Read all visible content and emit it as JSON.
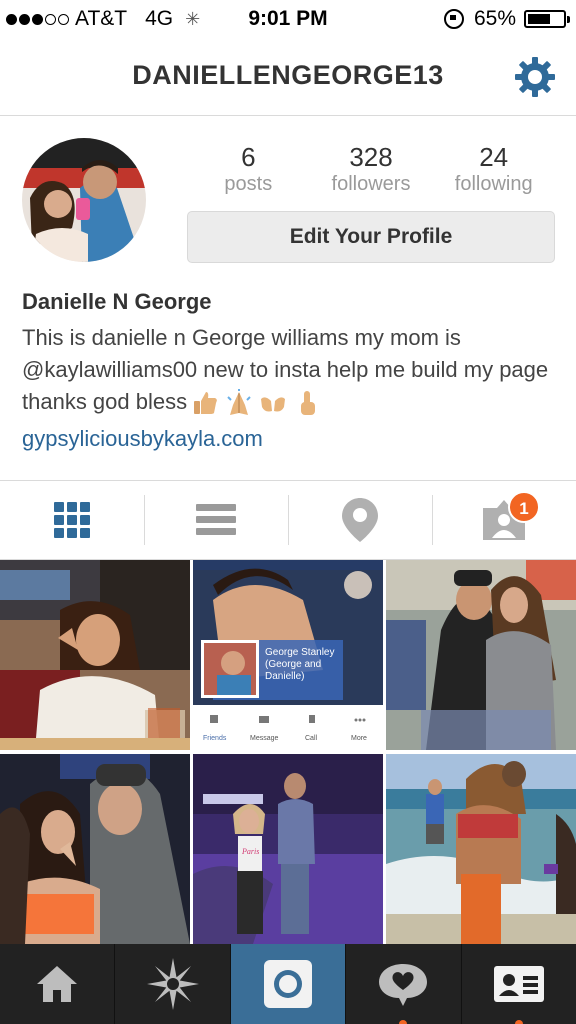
{
  "status_bar": {
    "carrier": "AT&T",
    "network": "4G",
    "time": "9:01 PM",
    "battery": "65%",
    "battery_level": 0.65,
    "signal_bars": 3,
    "signal_total": 5
  },
  "header": {
    "username": "DANIELLENGEORGE13",
    "settings_icon": "gear-icon"
  },
  "profile": {
    "stats": [
      {
        "value": "6",
        "label": "posts"
      },
      {
        "value": "328",
        "label": "followers"
      },
      {
        "value": "24",
        "label": "following"
      }
    ],
    "edit_button": "Edit Your Profile",
    "full_name": "Danielle N George",
    "bio": "This is danielle n George williams my mom is @kaylawilliams00 new to insta help me build my page thanks god bless",
    "bio_emojis": [
      "thumbs-up-icon",
      "praying-hands-icon",
      "open-hands-icon",
      "pointing-up-icon"
    ],
    "website": "gypsyliciousbykayla.com"
  },
  "tabs": {
    "items": [
      "grid-view-icon",
      "list-view-icon",
      "location-icon",
      "tagged-photos-icon"
    ],
    "tagged_badge": "1",
    "active": 0
  },
  "photos": {
    "fb_card": {
      "name": "George Stanley (George and Danielle)",
      "actions": [
        "Friends",
        "Message",
        "Call",
        "More"
      ]
    },
    "shirt_text": "Paris"
  },
  "bottom_nav": {
    "items": [
      "home-icon",
      "explore-icon",
      "camera-icon",
      "activity-icon",
      "profile-icon"
    ],
    "active": 4
  },
  "colors": {
    "accent_blue": "#3a6e97",
    "link_blue": "#2a6496",
    "badge_orange": "#f26522",
    "nav_bg": "#222222"
  }
}
